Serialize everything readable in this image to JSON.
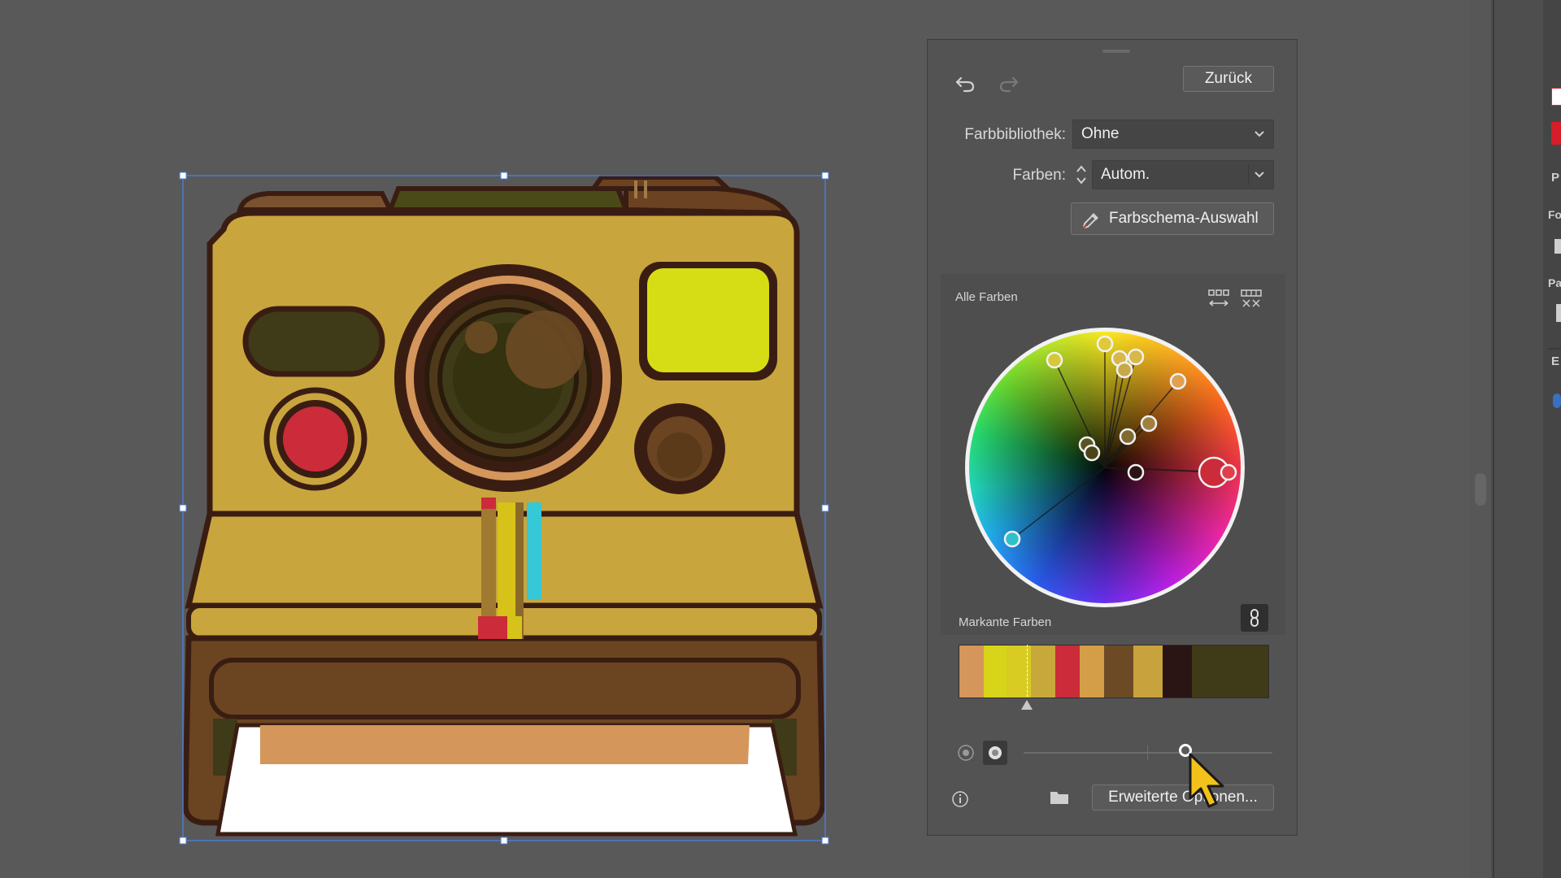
{
  "panel": {
    "back_label": "Zurück",
    "library_label": "Farbbibliothek:",
    "library_value": "Ohne",
    "colors_label": "Farben:",
    "colors_value": "Autom.",
    "scheme_button": "Farbschema-Auswahl",
    "all_colors_label": "Alle Farben",
    "prominent_label": "Markante Farben",
    "advanced_button": "Erweiterte Optionen...",
    "swatches": [
      "#d4965a",
      "#d7d41a",
      "#d8cc22",
      "#c8a83a",
      "#cc2b3a",
      "#d49e48",
      "#6b4a25",
      "#c8a23c",
      "#2a1414",
      "#3f3a17",
      "#3f3a17"
    ],
    "slider_value": 0.65
  },
  "icons": {
    "undo": "undo-icon",
    "redo": "redo-icon",
    "eyedropper": "eyedropper-icon",
    "link": "link-icon",
    "info": "info-icon",
    "folder": "folder-icon",
    "cursor": "mouse-cursor-icon"
  },
  "edge_labels": [
    "P",
    "Fo",
    "Pa",
    "E"
  ]
}
